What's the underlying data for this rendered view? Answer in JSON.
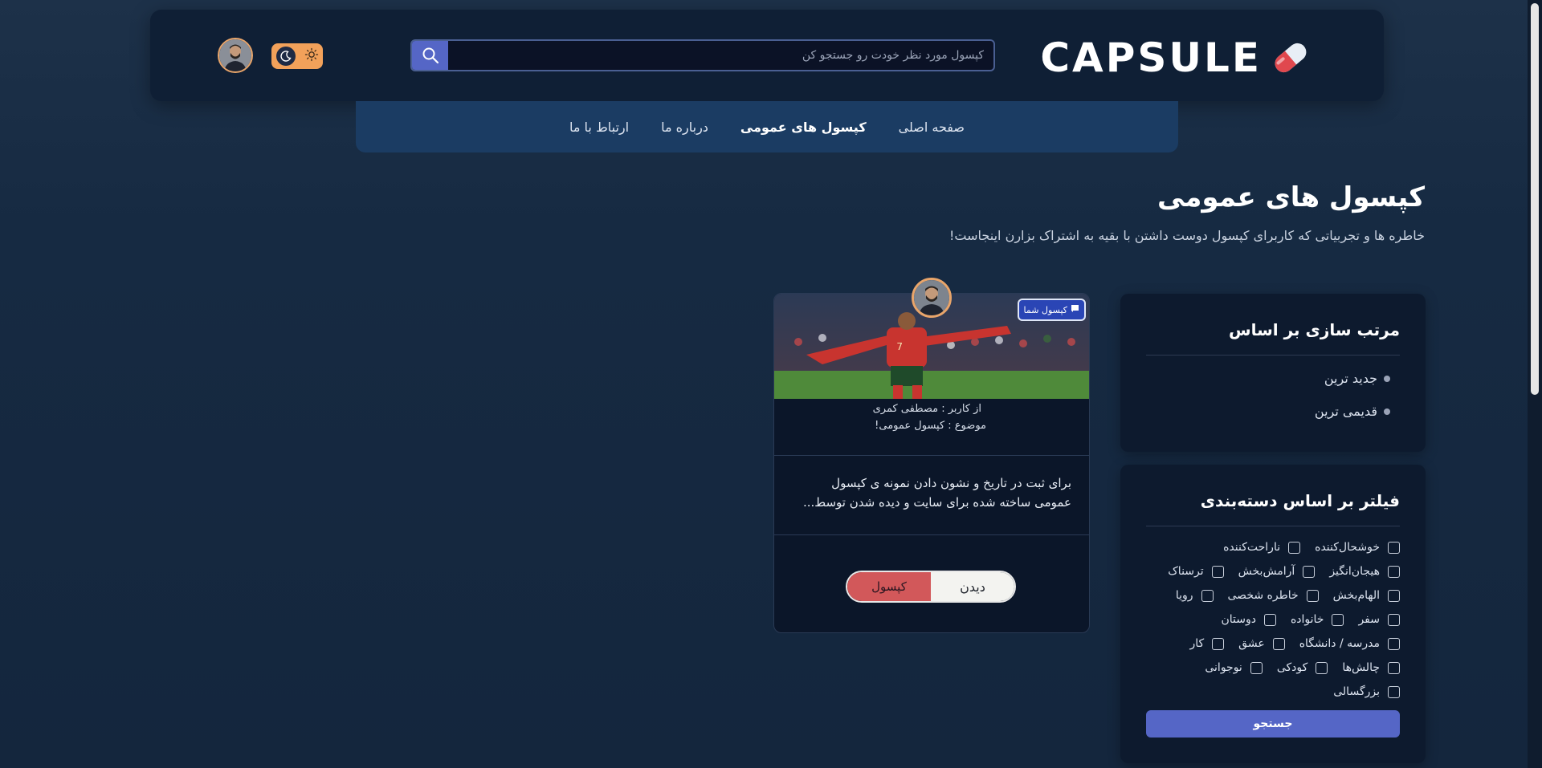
{
  "brand": {
    "logo_text": "CAPSULE"
  },
  "search": {
    "placeholder": "کپسول مورد نظر خودت رو جستجو کن"
  },
  "nav": {
    "items": [
      {
        "label": "صفحه اصلی"
      },
      {
        "label": "کپسول های عمومی"
      },
      {
        "label": "درباره ما"
      },
      {
        "label": "ارتباط با ما"
      }
    ]
  },
  "page": {
    "title": "کپسول های عمومی",
    "subtitle": "خاطره ها و تجربیاتی که کاربرای کپسول دوست داشتن با بقیه به اشتراک بزارن اینجاست!"
  },
  "sort": {
    "title": "مرتب سازی بر اساس",
    "items": [
      {
        "label": "جدید ترین"
      },
      {
        "label": "قدیمی ترین"
      }
    ]
  },
  "filter": {
    "title": "فیلتر بر اساس دسته‌بندی",
    "rows": [
      [
        "خوشحال‌کننده",
        "ناراحت‌کننده"
      ],
      [
        "هیجان‌انگیز",
        "آرامش‌بخش",
        "ترسناک"
      ],
      [
        "الهام‌بخش",
        "خاطره شخصی",
        "رویا"
      ],
      [
        "سفر",
        "خانواده",
        "دوستان"
      ],
      [
        "مدرسه / دانشگاه",
        "عشق",
        "کار"
      ],
      [
        "چالش‌ها",
        "کودکی",
        "نوجوانی"
      ],
      [
        "بزرگسالی"
      ]
    ],
    "search_button": "جستجو"
  },
  "card": {
    "badge": "کپسول شما",
    "user": "از کاربر : مصطفی کمری",
    "topic": "موضوع : کپسول عمومی!",
    "text": "برای ثبت در تاریخ و نشون دادن نمونه ی کپسول عمومی ساخته شده برای سایت و دیده شدن توسط...",
    "capsule_button": "کپسول",
    "view_button": "دیدن"
  },
  "colors": {
    "accent": "#5566c6",
    "orange": "#f2a15a",
    "capsule_red": "#d2585a"
  }
}
